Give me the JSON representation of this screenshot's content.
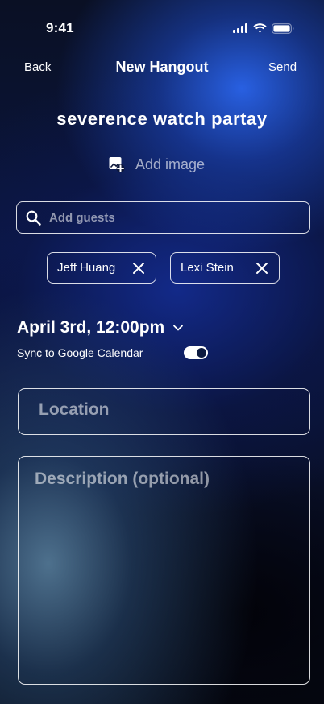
{
  "status_bar": {
    "time": "9:41",
    "icons": [
      "cellular-signal-icon",
      "wifi-icon",
      "battery-icon"
    ]
  },
  "nav": {
    "back_label": "Back",
    "title": "New Hangout",
    "send_label": "Send"
  },
  "event": {
    "title": "severence watch partay"
  },
  "add_image": {
    "label": "Add image",
    "icon": "add-image-icon"
  },
  "guests": {
    "search_placeholder": "Add guests",
    "search_icon": "search-icon",
    "chips": [
      {
        "name": "Jeff Huang",
        "remove_icon": "close-icon"
      },
      {
        "name": "Lexi Stein",
        "remove_icon": "close-icon"
      }
    ]
  },
  "date": {
    "label": "April 3rd, 12:00pm",
    "icon": "chevron-down-icon"
  },
  "sync": {
    "label": "Sync to Google Calendar",
    "enabled": true
  },
  "location": {
    "placeholder": "Location",
    "value": ""
  },
  "description": {
    "placeholder": "Description (optional)",
    "value": ""
  },
  "colors": {
    "text": "#ffffff",
    "placeholder": "rgba(255,255,255,0.55)",
    "accent_blue": "#2a64eb"
  }
}
